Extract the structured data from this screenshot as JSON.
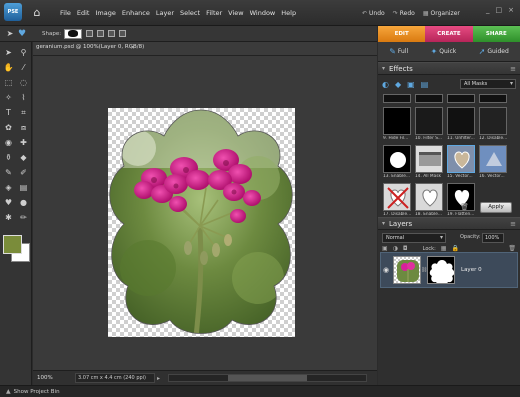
{
  "app": {
    "logo_text": "PSE"
  },
  "menubar": {
    "items": [
      "File",
      "Edit",
      "Image",
      "Enhance",
      "Layer",
      "Select",
      "Filter",
      "View",
      "Window",
      "Help"
    ],
    "undo": "Undo",
    "redo": "Redo",
    "organizer": "Organizer",
    "window_controls": [
      "_",
      "□",
      "×"
    ]
  },
  "options_bar": {
    "shape_label": "Shape:"
  },
  "mode_tabs": {
    "edit": "EDIT",
    "create": "CREATE",
    "share": "SHARE"
  },
  "sub_tabs": {
    "full": "Full",
    "quick": "Quick",
    "guided": "Guided"
  },
  "document": {
    "tab_title": "geranium.psd @ 100%(Layer 0, RGB/8)",
    "close": "×",
    "zoom": "100%",
    "info": "3.07 cm x 4.4 cm (240 ppi)",
    "info_arrow": "▸"
  },
  "effects_panel": {
    "title": "Effects",
    "filter": "All Masks",
    "apply_label": "Apply",
    "thumbs_row1": [
      {
        "label": "",
        "kind": "partial"
      },
      {
        "label": "",
        "kind": "partial"
      },
      {
        "label": "",
        "kind": "partial"
      },
      {
        "label": "",
        "kind": "partial"
      }
    ],
    "thumbs_row2": [
      {
        "label": "9. Hide Fil...",
        "kind": "mask"
      },
      {
        "label": "10. Filter S...",
        "kind": "mask"
      },
      {
        "label": "11. Unfilter...",
        "kind": "mask"
      },
      {
        "label": "12. Disable...",
        "kind": "mask"
      }
    ],
    "thumbs_row3": [
      {
        "label": "13. Enable...",
        "kind": "circle"
      },
      {
        "label": "14. All Mask",
        "kind": "rect"
      },
      {
        "label": "15. Vector...",
        "kind": "photo-heart"
      },
      {
        "label": "16. Vector...",
        "kind": "photo-shape"
      }
    ],
    "thumbs_row4": [
      {
        "label": "17. Disable...",
        "kind": "x"
      },
      {
        "label": "18. Enable...",
        "kind": "heart-white"
      },
      {
        "label": "19. Flatten...",
        "kind": "heart-black"
      }
    ]
  },
  "layers_panel": {
    "title": "Layers",
    "blend_mode": "Normal",
    "opacity_label": "Opacity:",
    "opacity_value": "100%",
    "lock_label": "Lock:",
    "layer_name": "Layer 0"
  },
  "bottom_bar": {
    "label": "Show Project Bin"
  },
  "colors": {
    "foreground": "#7a8c3a",
    "background": "#ffffff",
    "accent_edit": "#f0962a",
    "accent_create": "#d63a70",
    "accent_share": "#49ab42"
  }
}
